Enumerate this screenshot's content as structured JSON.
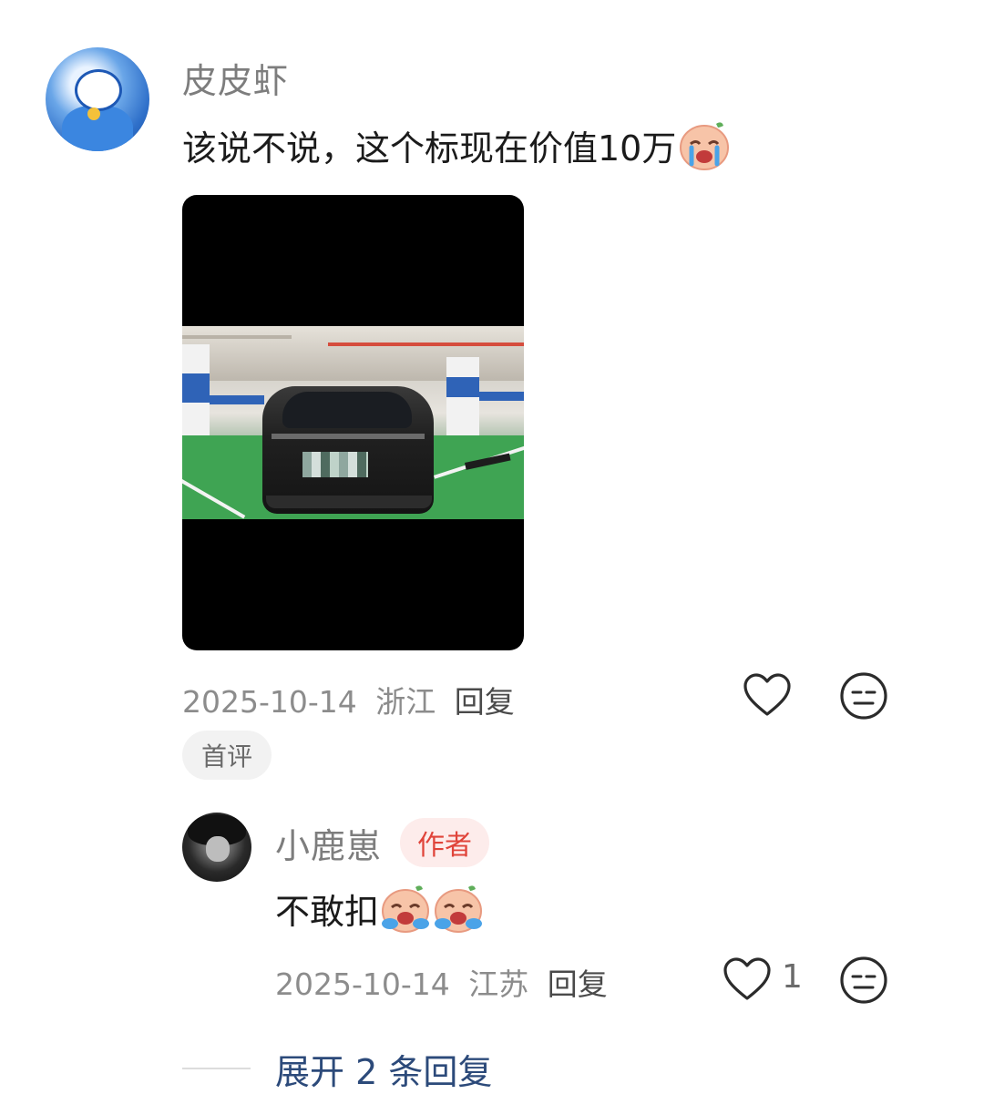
{
  "comment": {
    "username": "皮皮虾",
    "text": "该说不说，这个标现在价值10万",
    "date": "2025-10-14",
    "location": "浙江",
    "reply_label": "回复",
    "tag": "首评"
  },
  "reply": {
    "username": "小鹿崽",
    "author_badge": "作者",
    "text": "不敢扣",
    "date": "2025-10-14",
    "location": "江苏",
    "reply_label": "回复",
    "like_count": "1"
  },
  "expand": {
    "label": "展开 2 条回复"
  },
  "icons": {
    "like": "heart-outline-icon",
    "dislike": "neutral-face-icon",
    "crying_emoji": "crying-peach-emoji"
  },
  "colors": {
    "username": "#7d7d7d",
    "author_badge_text": "#e0443a",
    "author_badge_bg": "#fdeceb",
    "expand_text": "#2c4a7a"
  }
}
